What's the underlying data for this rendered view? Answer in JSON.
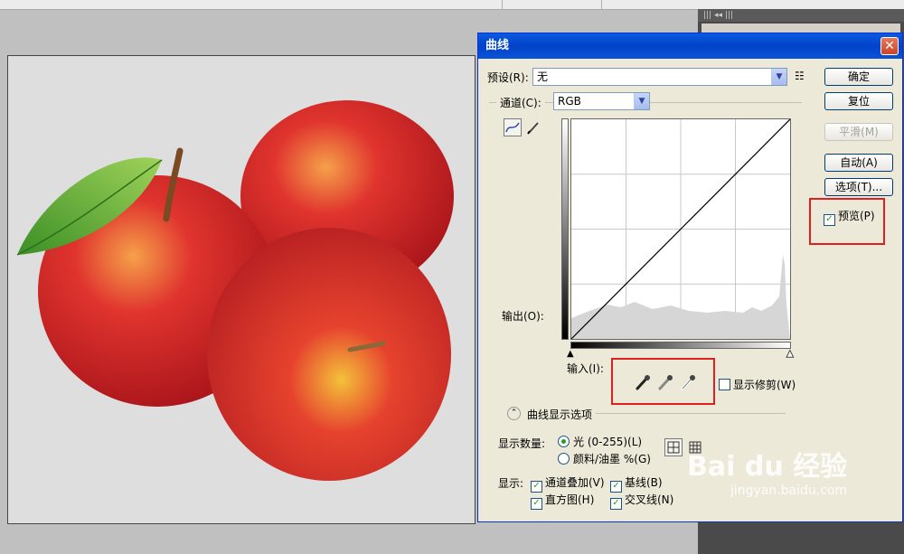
{
  "dialog": {
    "title": "曲线",
    "close_symbol": "✕",
    "preset_label": "预设(R):",
    "preset_value": "无",
    "channel_label": "通道(C):",
    "channel_value": "RGB",
    "output_label": "输出(O):",
    "input_label": "输入(I):",
    "show_clipping_label": "显示修剪(W)",
    "curve_display_options_label": "曲线显示选项",
    "show_amount_label": "显示数量:",
    "radio_light": "光 (0-255)(L)",
    "radio_pigment": "颜料/油墨 %(G)",
    "show_label": "显示:",
    "cb_channel_overlay": "通道叠加(V)",
    "cb_baseline": "基线(B)",
    "cb_histogram": "直方图(H)",
    "cb_intersection": "交叉线(N)"
  },
  "buttons": {
    "ok": "确定",
    "reset": "复位",
    "smooth": "平滑(M)",
    "auto": "自动(A)",
    "options": "选项(T)..."
  },
  "preview_label": "预览(P)",
  "panel_bar_text": "|||  ◂◂  |||",
  "watermark": {
    "brand": "Bai du 经验",
    "url": "jingyan.baidu.com"
  },
  "colors": {
    "titlebar": "#0142c8",
    "dialog_bg": "#ece9d8",
    "highlight_red": "#e0201e",
    "check_green": "#21a121"
  }
}
